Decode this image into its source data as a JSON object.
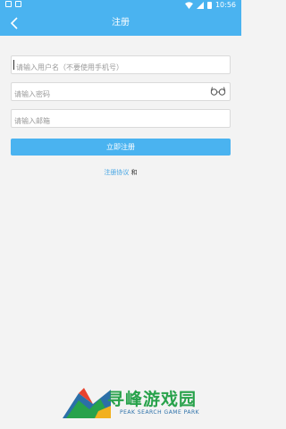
{
  "status_bar": {
    "time": "10:56"
  },
  "app_bar": {
    "title": "注册"
  },
  "form": {
    "username_placeholder": "请输入用户名（不要使用手机号）",
    "password_placeholder": "请输入密码",
    "email_placeholder": "请输入邮箱",
    "submit_label": "立即注册"
  },
  "agreement": {
    "link_text": "注册协议",
    "and_text": "和"
  },
  "watermark": {
    "cn_text": "寻峰游戏园",
    "en_text": "PEAK SEARCH GAME PARK"
  },
  "colors": {
    "accent": "#4ab3f0",
    "link": "#3fa2e3",
    "background": "#f3f3f3",
    "watermark_green": "#28a24b",
    "watermark_blue": "#2b6fa8"
  },
  "icons": [
    "sim-icon",
    "sd-card-icon",
    "wifi-icon",
    "signal-icon",
    "battery-icon",
    "back-arrow-icon",
    "show-password-icon"
  ]
}
